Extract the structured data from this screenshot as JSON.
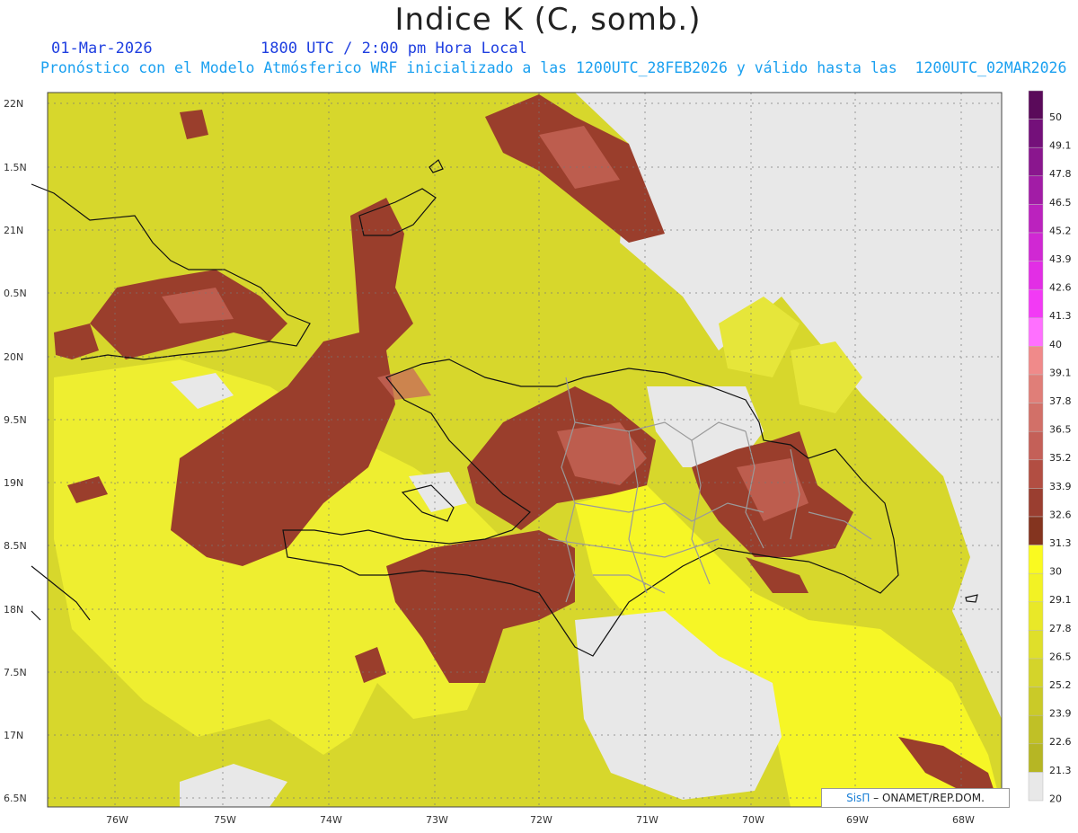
{
  "header": {
    "title": "Indice K (C, somb.)",
    "date": "01-Mar-2026",
    "time": "1800 UTC / 2:00 pm Hora Local",
    "subtitle": "Pronóstico con el Modelo Atmósferico WRF inicializado a las 1200UTC_28FEB2026 y válido hasta las  1200UTC_02MAR2026"
  },
  "axes": {
    "lat_labels": [
      "22N",
      "1.5N",
      "21N",
      "0.5N",
      "20N",
      "9.5N",
      "19N",
      "8.5N",
      "18N",
      "7.5N",
      "17N",
      "6.5N"
    ],
    "lon_labels": [
      "76W",
      "75W",
      "74W",
      "73W",
      "72W",
      "71W",
      "70W",
      "69W",
      "68W"
    ]
  },
  "colorbar": {
    "labels": [
      "50",
      "49.1",
      "47.8",
      "46.5",
      "45.2",
      "43.9",
      "42.6",
      "41.3",
      "40",
      "39.1",
      "37.8",
      "36.5",
      "35.2",
      "33.9",
      "32.6",
      "31.3",
      "30",
      "29.1",
      "27.8",
      "26.5",
      "25.2",
      "23.9",
      "22.6",
      "21.3",
      "20"
    ],
    "colors": [
      "#5a0a5a",
      "#74107a",
      "#8a168e",
      "#a21ca6",
      "#bb22be",
      "#d028d3",
      "#e22ee5",
      "#f23af5",
      "#ff70ff",
      "#f08a8a",
      "#e07e78",
      "#d27068",
      "#c46058",
      "#b24e42",
      "#9a3e30",
      "#84341f",
      "#fafa20",
      "#f2f224",
      "#e9e828",
      "#dfdf2a",
      "#d4d42a",
      "#caca28",
      "#c0c026",
      "#b6b624",
      "#e8e8e8"
    ]
  },
  "credit": {
    "brand": "SisΠ",
    "text": "– ONAMET/REP.DOM."
  },
  "colors": {
    "low": "#e8e8e8",
    "mid": "#dede2a",
    "high": "#9a3e2c"
  }
}
